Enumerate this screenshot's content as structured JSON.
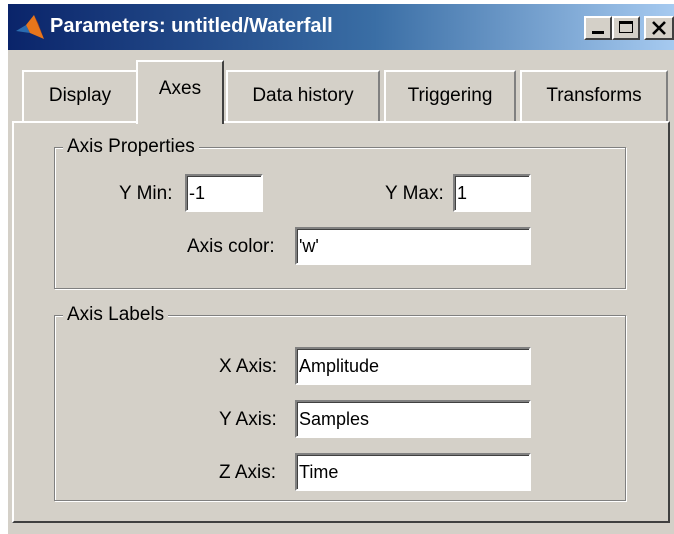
{
  "window": {
    "title": "Parameters: untitled/Waterfall",
    "close_glyph": "✕"
  },
  "tabs": [
    {
      "label": "Display"
    },
    {
      "label": "Axes",
      "selected": true
    },
    {
      "label": "Data history"
    },
    {
      "label": "Triggering"
    },
    {
      "label": "Transforms"
    }
  ],
  "axis_properties": {
    "legend": "Axis Properties",
    "ymin_label": "Y Min:",
    "ymin_value": "-1",
    "ymax_label": "Y Max:",
    "ymax_value": "1",
    "color_label": "Axis color:",
    "color_value": "'w'"
  },
  "axis_labels": {
    "legend": "Axis Labels",
    "x_label": "X Axis:",
    "x_value": "Amplitude",
    "y_label": "Y Axis:",
    "y_value": "Samples",
    "z_label": "Z Axis:",
    "z_value": "Time"
  },
  "icons": {
    "app": "matlab-logo-icon",
    "minimize": "minimize-icon",
    "maximize": "maximize-icon",
    "close": "close-icon"
  },
  "colors": {
    "face": "#d4d0c8",
    "title_start": "#0a246a",
    "title_end": "#a6caf0"
  }
}
